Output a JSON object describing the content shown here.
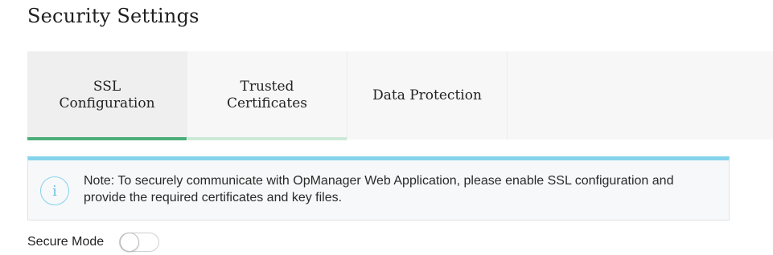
{
  "page": {
    "title": "Security Settings"
  },
  "tabs": [
    {
      "label": "SSL\nConfiguration",
      "state": "active"
    },
    {
      "label": "Trusted\nCertificates",
      "state": "inactive"
    },
    {
      "label": "Data Protection",
      "state": "inactive"
    }
  ],
  "note": {
    "icon": "info-icon",
    "text": "Note: To securely communicate with OpManager Web Application, please enable SSL configuration and provide the required certificates and key files."
  },
  "secure_mode": {
    "label": "Secure Mode",
    "enabled": false
  },
  "colors": {
    "active_tab_underline": "#4caf7a",
    "secondary_tab_underline": "#cce9d8",
    "note_accent": "#86d3ec"
  }
}
